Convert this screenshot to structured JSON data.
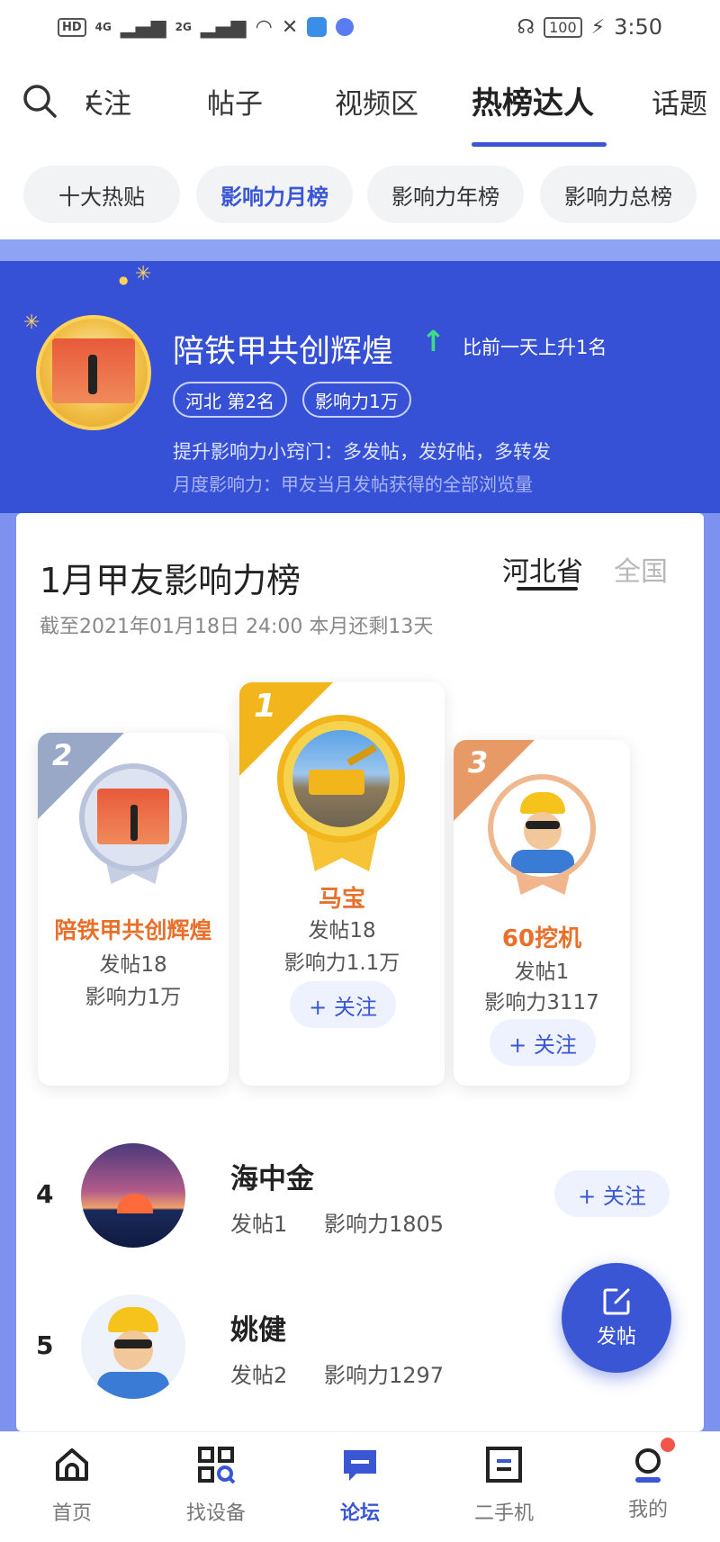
{
  "status_bar": {
    "hd": "HD",
    "sig1": "4G",
    "sig2": "2G",
    "battery": "100",
    "time": "3:50"
  },
  "top_nav": {
    "tabs": [
      "关注",
      "帖子",
      "视频区",
      "热榜达人",
      "话题"
    ],
    "active_index": 3
  },
  "sub_tabs": [
    "十大热贴",
    "影响力月榜",
    "影响力年榜",
    "影响力总榜"
  ],
  "banner": {
    "name": "陪铁甲共创辉煌",
    "arrow": "↑",
    "rise_text": "比前一天上升1名",
    "chip_region": "河北 第2名",
    "chip_influence": "影响力1万",
    "tip": "提升影响力小窍门：多发帖，发好帖，多转发",
    "definition": "月度影响力：甲友当月发帖获得的全部浏览量"
  },
  "ranking": {
    "title": "1月甲友影响力榜",
    "region_active": "河北省",
    "region_other": "全国",
    "deadline": "截至2021年01月18日 24:00 本月还剩13天",
    "podium": [
      {
        "rank": "2",
        "name": "陪铁甲共创辉煌",
        "posts": "发帖18",
        "influence": "影响力1万"
      },
      {
        "rank": "1",
        "name": "马宝",
        "posts": "发帖18",
        "influence": "影响力1.1万",
        "follow": "+ 关注"
      },
      {
        "rank": "3",
        "name": "60挖机",
        "posts": "发帖1",
        "influence": "影响力3117",
        "follow": "+ 关注"
      }
    ],
    "list": [
      {
        "rank": "4",
        "name": "海中金",
        "posts": "发帖1",
        "influence": "影响力1805",
        "follow": "+ 关注"
      },
      {
        "rank": "5",
        "name": "姚健",
        "posts": "发帖2",
        "influence": "影响力1297"
      }
    ]
  },
  "fab": {
    "label": "发帖"
  },
  "bottom_nav": {
    "items": [
      "首页",
      "找设备",
      "论坛",
      "二手机",
      "我的"
    ],
    "active_index": 2
  },
  "colors": {
    "accent": "#3a56d4",
    "banner": "#3650d6",
    "gold": "#f2b51c",
    "bronze": "#e89a66",
    "silver": "#9aa8c8",
    "orange_name": "#e8702a"
  }
}
